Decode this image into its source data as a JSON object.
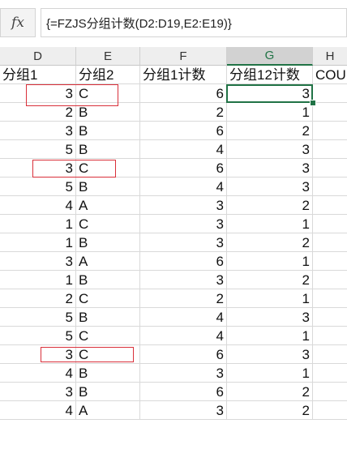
{
  "formula_bar": {
    "fx_label": "fx",
    "formula": "{=FZJS分组计数(D2:D19,E2:E19)}"
  },
  "columns": [
    "D",
    "E",
    "F",
    "G",
    "H"
  ],
  "header_row": {
    "d": "分组1",
    "e": "分组2",
    "f": "分组1计数",
    "g": "分组12计数",
    "h": "COUN"
  },
  "rows": [
    {
      "d": "3",
      "e": "C",
      "f": "6",
      "g": "3"
    },
    {
      "d": "2",
      "e": "B",
      "f": "2",
      "g": "1"
    },
    {
      "d": "3",
      "e": "B",
      "f": "6",
      "g": "2"
    },
    {
      "d": "5",
      "e": "B",
      "f": "4",
      "g": "3"
    },
    {
      "d": "3",
      "e": "C",
      "f": "6",
      "g": "3"
    },
    {
      "d": "5",
      "e": "B",
      "f": "4",
      "g": "3"
    },
    {
      "d": "4",
      "e": "A",
      "f": "3",
      "g": "2"
    },
    {
      "d": "1",
      "e": "C",
      "f": "3",
      "g": "1"
    },
    {
      "d": "1",
      "e": "B",
      "f": "3",
      "g": "2"
    },
    {
      "d": "3",
      "e": "A",
      "f": "6",
      "g": "1"
    },
    {
      "d": "1",
      "e": "B",
      "f": "3",
      "g": "2"
    },
    {
      "d": "2",
      "e": "C",
      "f": "2",
      "g": "1"
    },
    {
      "d": "5",
      "e": "B",
      "f": "4",
      "g": "3"
    },
    {
      "d": "5",
      "e": "C",
      "f": "4",
      "g": "1"
    },
    {
      "d": "3",
      "e": "C",
      "f": "6",
      "g": "3"
    },
    {
      "d": "4",
      "e": "B",
      "f": "3",
      "g": "1"
    },
    {
      "d": "3",
      "e": "B",
      "f": "6",
      "g": "2"
    },
    {
      "d": "4",
      "e": "A",
      "f": "3",
      "g": "2"
    }
  ],
  "colors": {
    "selection": "#217346",
    "highlight": "#d9303a",
    "header_bg": "#eeeeee"
  }
}
